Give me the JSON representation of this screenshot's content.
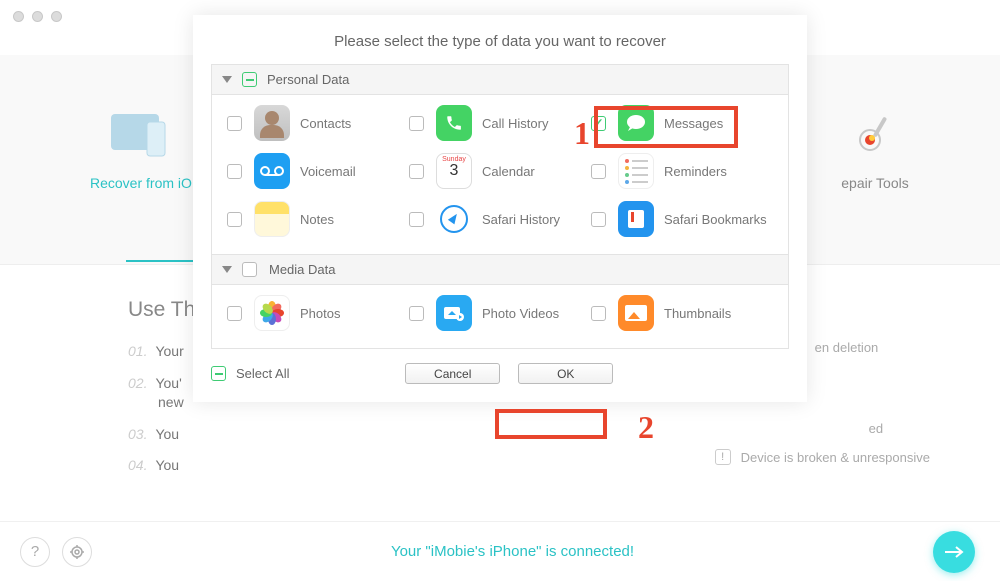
{
  "background": {
    "tabs": {
      "recover_ios": "Recover from iO",
      "repair_tools": "epair Tools"
    },
    "steps": {
      "title": "Use Thi",
      "s1_num": "01.",
      "s1": "Your",
      "s2_num": "02.",
      "s2": "You'",
      "s2b": "new",
      "s3_num": "03.",
      "s3": "You",
      "s4_num": "04.",
      "s4": "You"
    },
    "right": {
      "deletion": "en deletion",
      "ed": "ed",
      "broken": "Device is broken & unresponsive"
    },
    "bottom": "Your \"iMobie's iPhone\" is connected!"
  },
  "modal": {
    "title": "Please select the type of data you want to recover",
    "section_personal": "Personal Data",
    "section_media": "Media Data",
    "items": {
      "contacts": "Contacts",
      "callhistory": "Call History",
      "messages": "Messages",
      "voicemail": "Voicemail",
      "calendar": "Calendar",
      "reminders": "Reminders",
      "notes": "Notes",
      "safari_history": "Safari History",
      "safari_bookmarks": "Safari Bookmarks",
      "photos": "Photos",
      "photo_videos": "Photo Videos",
      "thumbnails": "Thumbnails"
    },
    "calendar_day": "3",
    "calendar_top": "Sunday",
    "select_all": "Select All",
    "cancel": "Cancel",
    "ok": "OK"
  },
  "annotations": {
    "one": "1",
    "two": "2"
  }
}
